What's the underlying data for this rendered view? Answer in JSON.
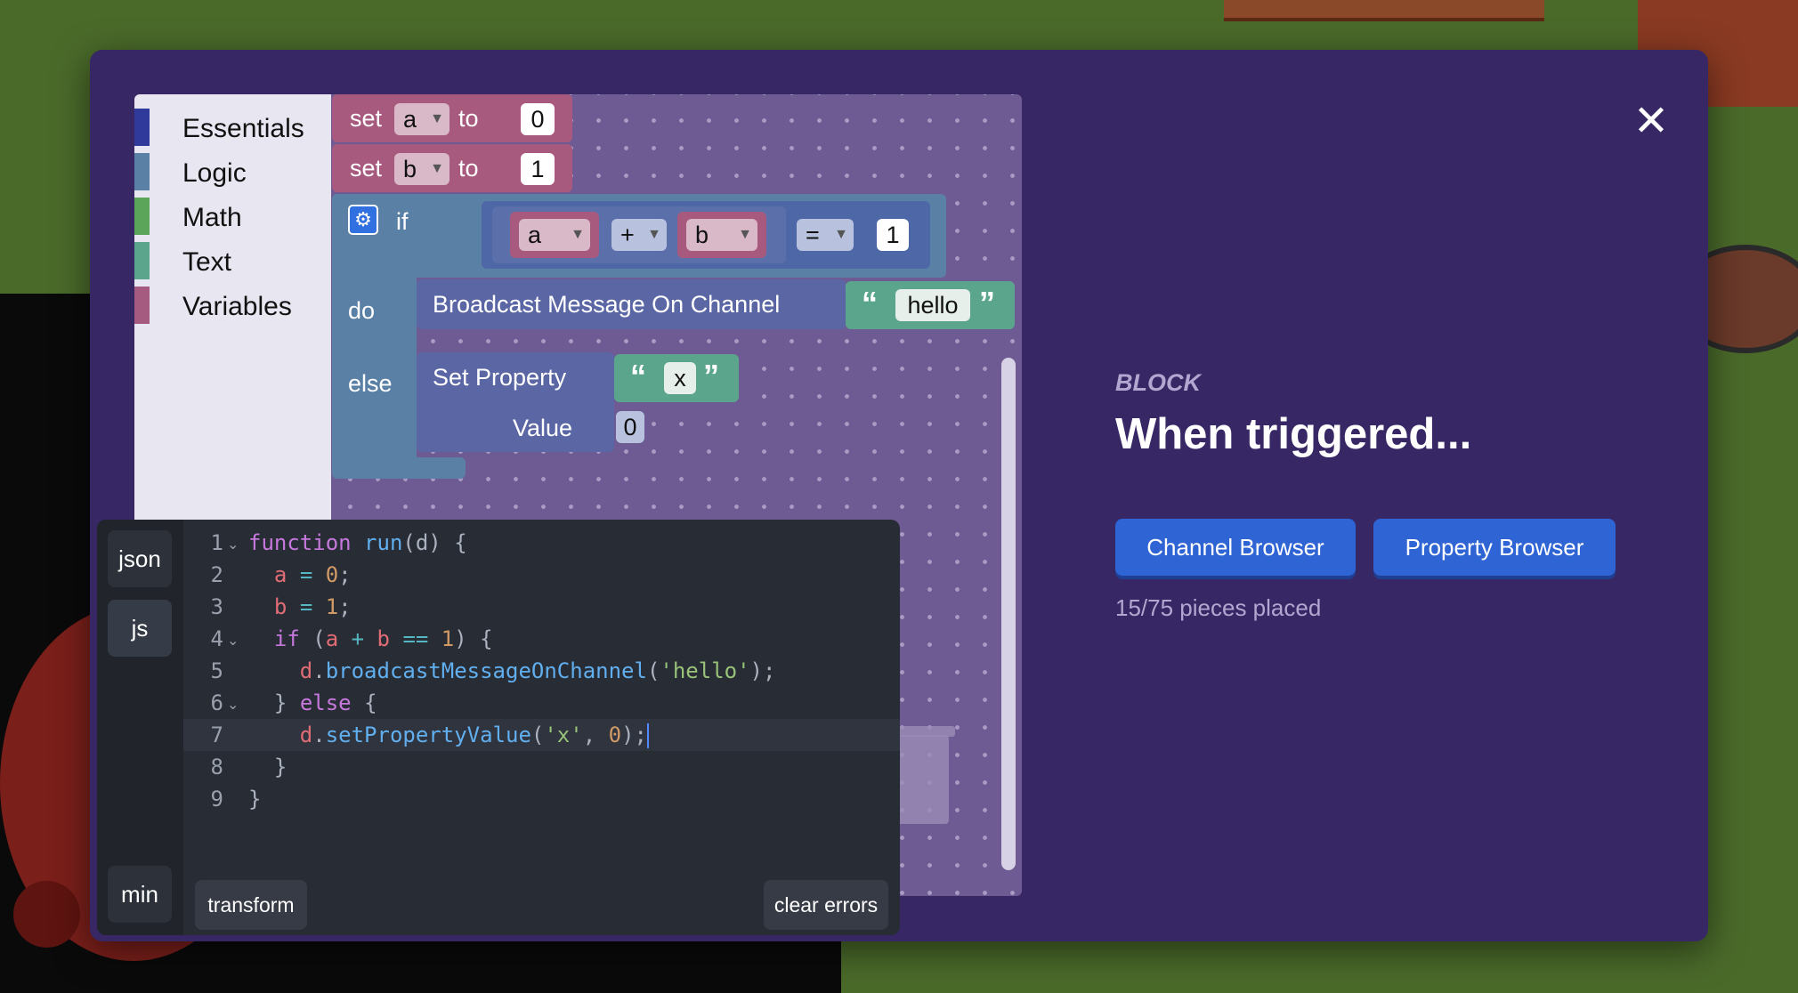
{
  "toolbox": {
    "categories": [
      {
        "label": "Essentials",
        "color": "#2f3a9b"
      },
      {
        "label": "Logic",
        "color": "#5b80a5"
      },
      {
        "label": "Math",
        "color": "#5ba55b"
      },
      {
        "label": "Text",
        "color": "#5ba58c"
      },
      {
        "label": "Variables",
        "color": "#a55b80"
      }
    ]
  },
  "blocks": {
    "set_a": {
      "keyword": "set",
      "var": "a",
      "to": "to",
      "value": "0"
    },
    "set_b": {
      "keyword": "set",
      "var": "b",
      "to": "to",
      "value": "1"
    },
    "if_block": {
      "if": "if",
      "do": "do",
      "else": "else",
      "left_var": "a",
      "arith_op": "+",
      "right_var": "b",
      "compare_op": "=",
      "compare_value": "1"
    },
    "broadcast": {
      "label": "Broadcast Message On Channel",
      "open_quote": "“",
      "value": "hello",
      "close_quote": "”"
    },
    "set_property": {
      "label": "Set Property",
      "open_quote": "“",
      "key": "x",
      "close_quote": "”",
      "value_label": "Value",
      "value": "0"
    }
  },
  "editor": {
    "tabs": {
      "json": "json",
      "js": "js",
      "min": "min"
    },
    "line_numbers": [
      "1",
      "2",
      "3",
      "4",
      "5",
      "6",
      "7",
      "8",
      "9"
    ],
    "transform_label": "transform",
    "clear_errors_label": "clear errors"
  },
  "panel": {
    "eyebrow": "BLOCK",
    "headline": "When triggered...",
    "channel_browser": "Channel Browser",
    "property_browser": "Property Browser",
    "progress": "15/75 pieces placed"
  },
  "close_icon": "close-icon",
  "colors": {
    "modal_bg": "#382765",
    "button": "#2f64d4",
    "workspace": "#6e5b93"
  }
}
